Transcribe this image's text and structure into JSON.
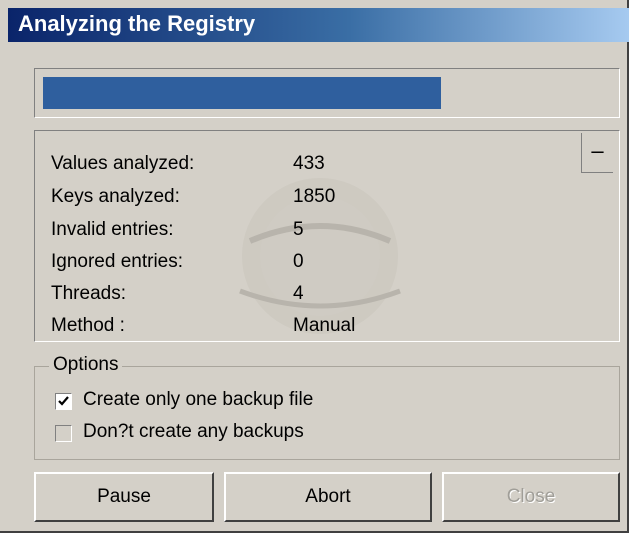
{
  "window": {
    "title": "Analyzing the Registry"
  },
  "progress": {
    "fraction": 0.7
  },
  "stats": {
    "collapse_label": "–",
    "rows": [
      {
        "label": "Values analyzed:",
        "value": "433"
      },
      {
        "label": "Keys analyzed:",
        "value": "1850"
      },
      {
        "label": "Invalid entries:",
        "value": "5"
      },
      {
        "label": "Ignored entries:",
        "value": "0"
      },
      {
        "label": "Threads:",
        "value": "4"
      },
      {
        "label": "Method :",
        "value": "Manual"
      }
    ]
  },
  "options": {
    "legend": "Options",
    "items": [
      {
        "label": "Create only one backup file",
        "checked": true,
        "enabled": true
      },
      {
        "label": "Don?t create any backups",
        "checked": false,
        "enabled": false
      }
    ]
  },
  "buttons": {
    "pause": "Pause",
    "abort": "Abort",
    "close": "Close"
  },
  "colors": {
    "progress": "#2f5f9e",
    "dialog": "#d4d0c8",
    "title_start": "#0a246a"
  }
}
